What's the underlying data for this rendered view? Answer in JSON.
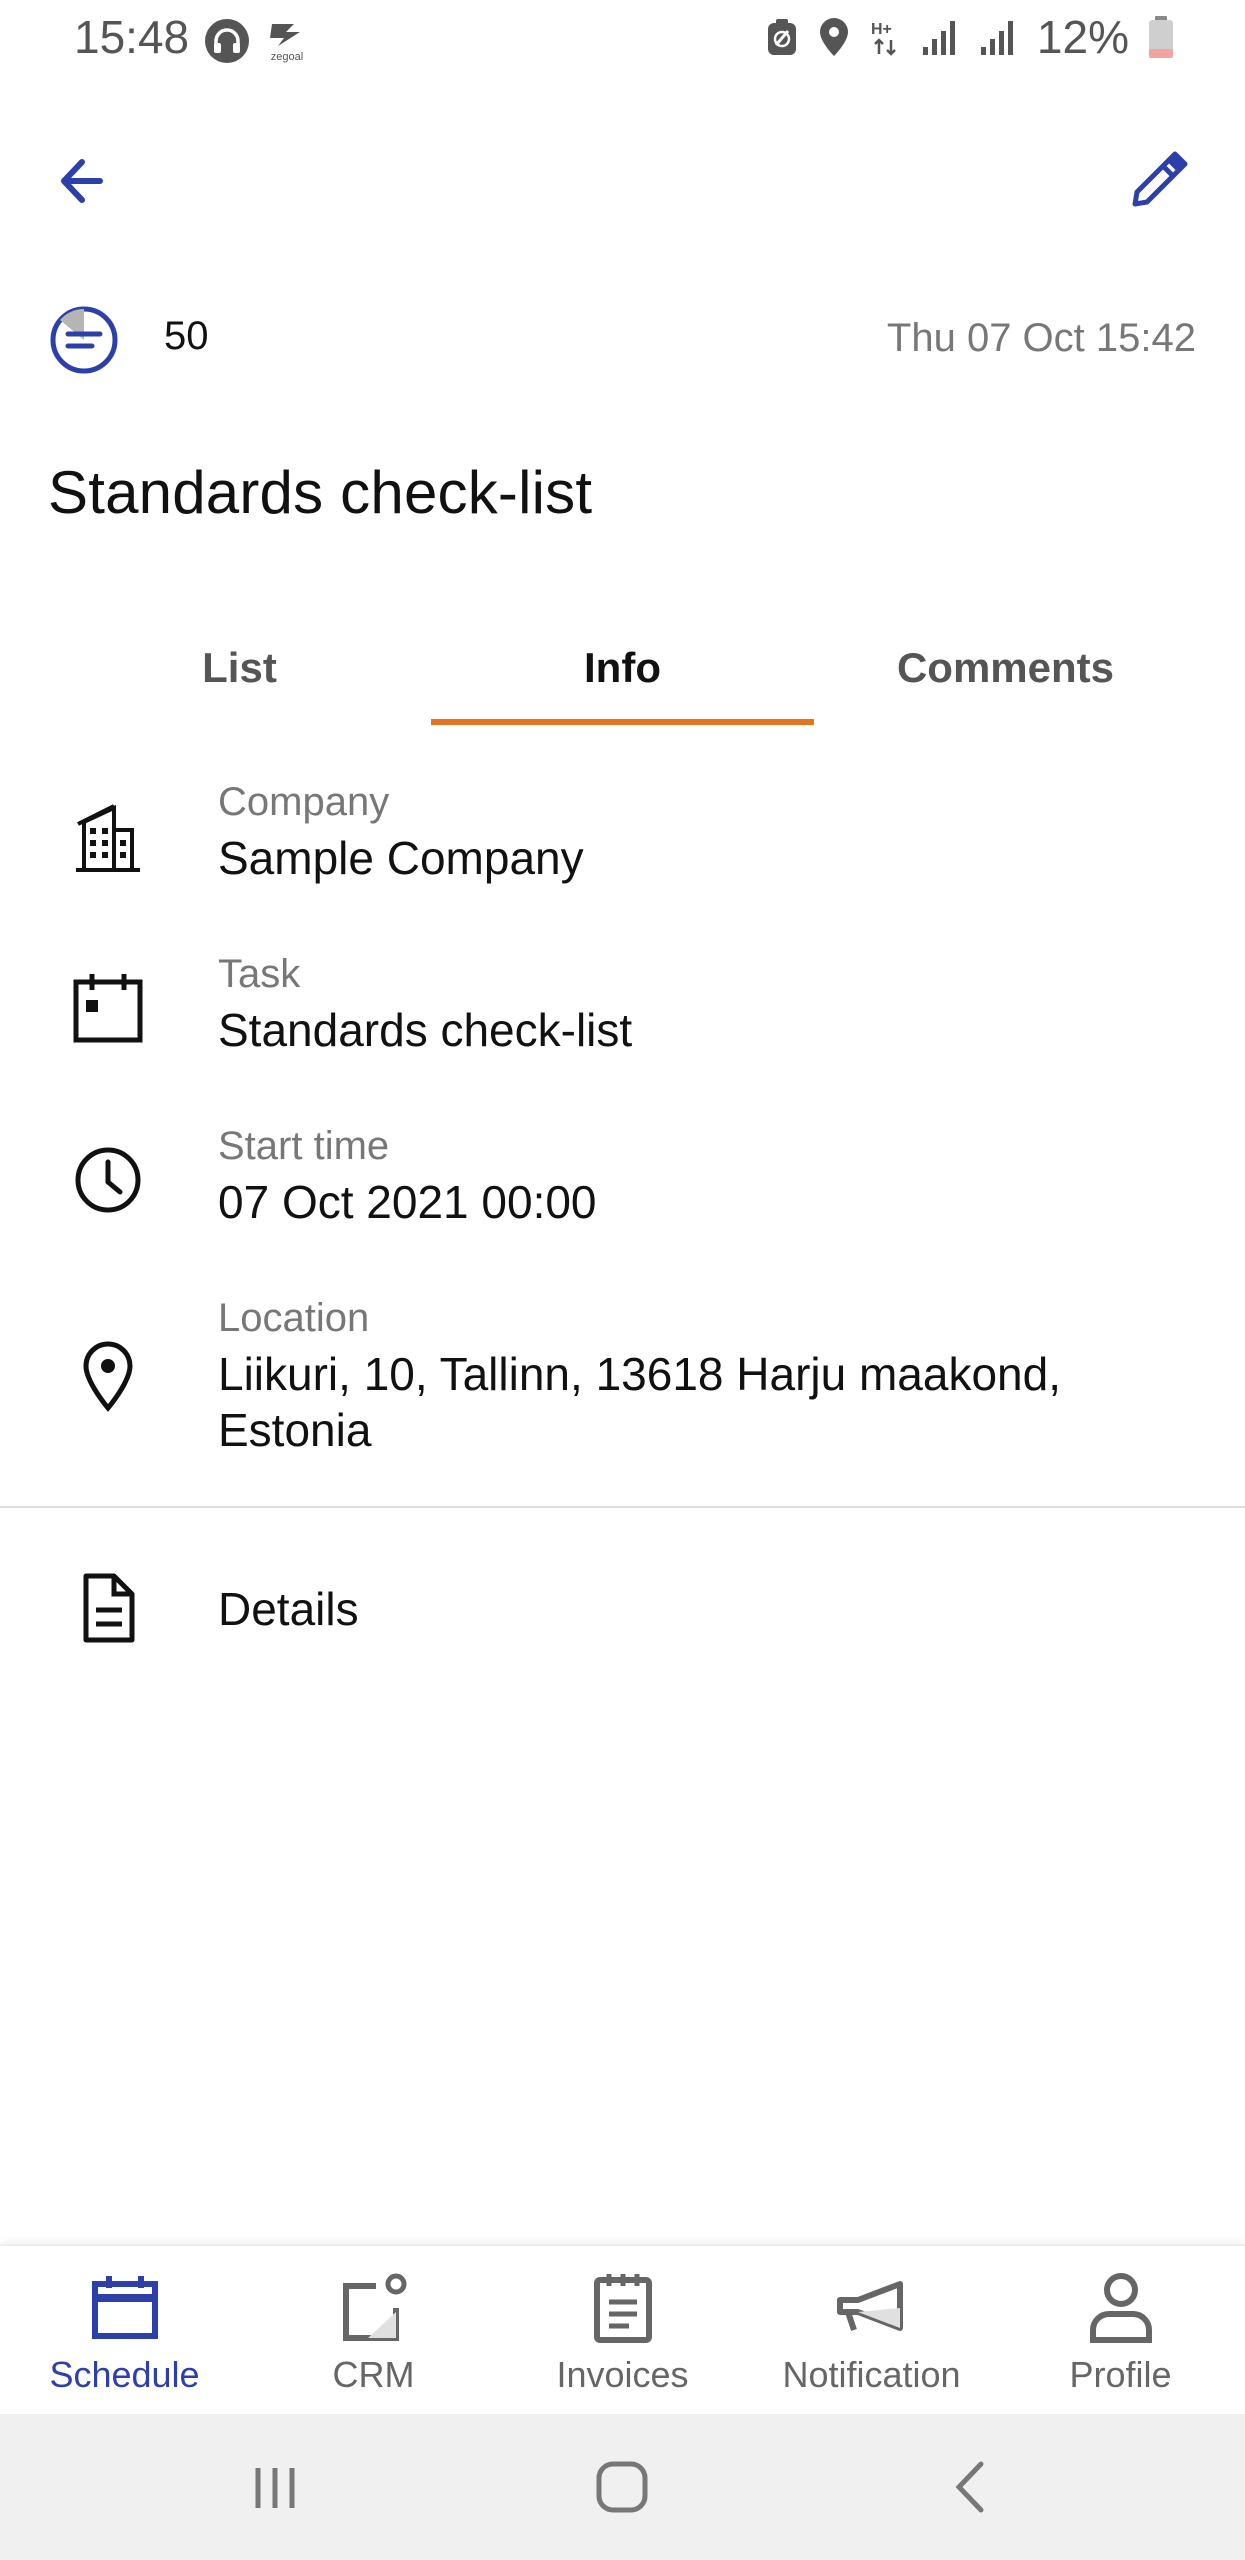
{
  "status_bar": {
    "time": "15:48",
    "battery": "12%",
    "app_icons": [
      "headphones-icon",
      "zegoal-icon"
    ],
    "right_icons": [
      "data-saver-icon",
      "location-icon",
      "network-h-plus-icon",
      "signal-icon",
      "signal-icon",
      "battery-icon"
    ],
    "zegoal_text": "zegoal"
  },
  "app_bar": {
    "back_icon": "arrow-left-icon",
    "edit_icon": "pencil-icon"
  },
  "task": {
    "number": "50",
    "date": "Thu 07 Oct 15:42",
    "title": "Standards check-list"
  },
  "tabs": [
    {
      "label": "List",
      "active": false
    },
    {
      "label": "Info",
      "active": true
    },
    {
      "label": "Comments",
      "active": false
    }
  ],
  "info": {
    "company": {
      "label": "Company",
      "value": "Sample Company",
      "icon": "building-icon"
    },
    "task": {
      "label": "Task",
      "value": "Standards check-list",
      "icon": "calendar-icon"
    },
    "start_time": {
      "label": "Start time",
      "value": "07 Oct 2021 00:00",
      "icon": "clock-icon"
    },
    "location": {
      "label": "Location",
      "value": "Liikuri, 10, Tallinn, 13618 Harju maakond, Estonia",
      "icon": "map-pin-icon"
    }
  },
  "details": {
    "label": "Details",
    "icon": "document-icon"
  },
  "bottom_nav": [
    {
      "label": "Schedule",
      "icon": "calendar-icon",
      "active": true
    },
    {
      "label": "CRM",
      "icon": "crm-icon",
      "active": false
    },
    {
      "label": "Invoices",
      "icon": "clipboard-icon",
      "active": false
    },
    {
      "label": "Notification",
      "icon": "megaphone-icon",
      "active": false
    },
    {
      "label": "Profile",
      "icon": "person-icon",
      "active": false
    }
  ],
  "colors": {
    "accent": "#2d3fa8",
    "tab_indicator": "#e8731e",
    "muted_text": "#777777"
  }
}
